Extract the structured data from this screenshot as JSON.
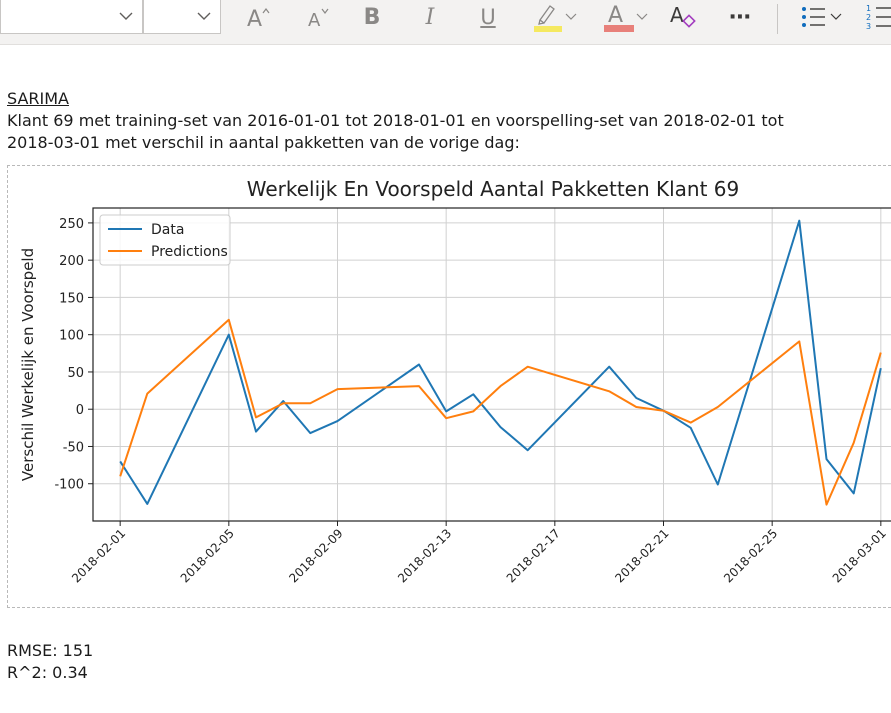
{
  "toolbar": {
    "icons": [
      "chevron-down-icon",
      "chevron-down-icon",
      "grow-font-icon",
      "shrink-font-icon",
      "bold-icon",
      "italic-icon",
      "underline-icon",
      "highlighter-icon",
      "chevron-down-icon",
      "font-color-icon",
      "chevron-down-icon",
      "clear-formatting-icon",
      "more-icon",
      "bullet-list-icon",
      "chevron-down-icon",
      "numbered-list-icon"
    ],
    "bold": "B",
    "italic": "I",
    "underline": "U",
    "more": "⋯",
    "highlight_color": "#f5e960",
    "font_color": "#e8807a",
    "clear_color": "#a23cbf"
  },
  "document": {
    "heading": "SARIMA",
    "line1": "Klant 69 met training-set van 2016-01-01 tot 2018-01-01 en voorspelling-set van 2018-02-01 tot",
    "line2": "2018-03-01 met verschil in aantal pakketten van de vorige dag:",
    "rmse": "RMSE: 151",
    "r2": "R^2: 0.34"
  },
  "chart_data": {
    "type": "line",
    "title": "Werkelijk En Voorspeld Aantal Pakketten Klant 69",
    "xlabel": "",
    "ylabel": "Verschil Werkelijk en Voorspeld",
    "x_tick_labels": [
      "2018-02-01",
      "2018-02-05",
      "2018-02-09",
      "2018-02-13",
      "2018-02-17",
      "2018-02-21",
      "2018-02-25",
      "2018-03-01"
    ],
    "x_tick_days": [
      0,
      4,
      8,
      12,
      16,
      20,
      24,
      28
    ],
    "y_ticks": [
      -100,
      -50,
      0,
      50,
      100,
      150,
      200,
      250
    ],
    "ylim": [
      -150,
      270
    ],
    "xlim_days": [
      -1,
      29
    ],
    "grid": true,
    "legend_position": "top-left",
    "x": [
      "2018-02-01",
      "2018-02-02",
      "2018-02-05",
      "2018-02-06",
      "2018-02-07",
      "2018-02-08",
      "2018-02-09",
      "2018-02-12",
      "2018-02-13",
      "2018-02-14",
      "2018-02-15",
      "2018-02-16",
      "2018-02-19",
      "2018-02-20",
      "2018-02-21",
      "2018-02-22",
      "2018-02-23",
      "2018-02-26",
      "2018-02-27",
      "2018-02-28",
      "2018-03-01"
    ],
    "series": [
      {
        "name": "Data",
        "color": "#1f77b4",
        "values": [
          -70,
          -127,
          100,
          -30,
          11,
          -32,
          -16,
          60,
          -3,
          20,
          -24,
          -55,
          57,
          15,
          -2,
          -25,
          -101,
          253,
          -67,
          -113,
          55
        ]
      },
      {
        "name": "Predictions",
        "color": "#ff7f0e",
        "values": [
          -90,
          21,
          120,
          -11,
          8,
          8,
          27,
          31,
          -12,
          -3,
          31,
          57,
          24,
          3,
          -2,
          -18,
          3,
          91,
          -128,
          -45,
          76
        ]
      }
    ]
  }
}
